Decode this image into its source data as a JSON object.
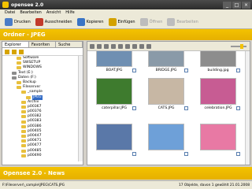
{
  "window": {
    "title": "opensee 2.0"
  },
  "menu": [
    "Datei",
    "Bearbeiten",
    "Ansicht",
    "Hilfe"
  ],
  "toolbar": [
    {
      "label": "Drucken",
      "icon": "printer-icon",
      "color": "#4a7cc7",
      "disabled": false
    },
    {
      "label": "Ausschneiden",
      "icon": "scissors-icon",
      "color": "#c23b2b",
      "disabled": false
    },
    {
      "label": "Kopieren",
      "icon": "copy-icon",
      "color": "#3a74c5",
      "disabled": false
    },
    {
      "label": "Einfügen",
      "icon": "paste-icon",
      "color": "#d3a100",
      "disabled": false
    },
    {
      "label": "Öffnen",
      "icon": "open-icon",
      "color": "#bdbdbd",
      "disabled": true
    },
    {
      "label": "Bearbeiten",
      "icon": "edit-icon",
      "color": "#bdbdbd",
      "disabled": true
    }
  ],
  "folder_bar": "Ordner - JPEG",
  "left_tabs": [
    "Explorer",
    "Favoriten",
    "Suche"
  ],
  "tree": [
    {
      "label": "Software",
      "indent": 3,
      "type": "folder",
      "selected": false
    },
    {
      "label": "SWSETUP",
      "indent": 3,
      "type": "folder",
      "selected": false
    },
    {
      "label": "WINDOWS",
      "indent": 3,
      "type": "folder",
      "selected": false
    },
    {
      "label": "Text (E:)",
      "indent": 2,
      "type": "drive",
      "selected": false
    },
    {
      "label": "Daten (F:)",
      "indent": 2,
      "type": "drive",
      "selected": false
    },
    {
      "label": "Backup",
      "indent": 3,
      "type": "folder",
      "selected": false
    },
    {
      "label": "Fileserver",
      "indent": 3,
      "type": "folder",
      "selected": false
    },
    {
      "label": "_sample",
      "indent": 4,
      "type": "folder",
      "selected": false
    },
    {
      "label": "JPEG",
      "indent": 5,
      "type": "folder",
      "selected": true
    },
    {
      "label": "Archiv",
      "indent": 4,
      "type": "folder",
      "selected": false
    },
    {
      "label": "p00367",
      "indent": 4,
      "type": "folder",
      "selected": false
    },
    {
      "label": "p00376",
      "indent": 4,
      "type": "folder",
      "selected": false
    },
    {
      "label": "p00382",
      "indent": 4,
      "type": "folder",
      "selected": false
    },
    {
      "label": "p00383",
      "indent": 4,
      "type": "folder",
      "selected": false
    },
    {
      "label": "p00386",
      "indent": 4,
      "type": "folder",
      "selected": false
    },
    {
      "label": "p00405",
      "indent": 4,
      "type": "folder",
      "selected": false
    },
    {
      "label": "p00447",
      "indent": 4,
      "type": "folder",
      "selected": false
    },
    {
      "label": "p00471",
      "indent": 4,
      "type": "folder",
      "selected": false
    },
    {
      "label": "p00477",
      "indent": 4,
      "type": "folder",
      "selected": false
    },
    {
      "label": "p00485",
      "indent": 4,
      "type": "folder",
      "selected": false
    },
    {
      "label": "p00490",
      "indent": 4,
      "type": "folder",
      "selected": false
    }
  ],
  "thumbnails": [
    {
      "caption": "BOAT.JPG",
      "color": "#6f8fb2"
    },
    {
      "caption": "BRIDGE.JPG",
      "color": "#8a9aa8"
    },
    {
      "caption": "building.jpg",
      "color": "#8d8d8d"
    },
    {
      "caption": "caterpillar.JPG",
      "color": "#3e7b2e"
    },
    {
      "caption": "CATS.JPG",
      "color": "#c7b7a4"
    },
    {
      "caption": "celebration.JPG",
      "color": "#c75c93"
    },
    {
      "caption": "",
      "color": "#5a78a8"
    },
    {
      "caption": "",
      "color": "#6ea0d8"
    },
    {
      "caption": "",
      "color": "#e879a4"
    }
  ],
  "news_bar": "Opensee 2.0 - News",
  "status": {
    "left": "F:\\Fileserver\\_sample\\JPEG\\CATS.JPG",
    "right": "17 Objekte, davon 1 gewählt   21.01.2008"
  }
}
